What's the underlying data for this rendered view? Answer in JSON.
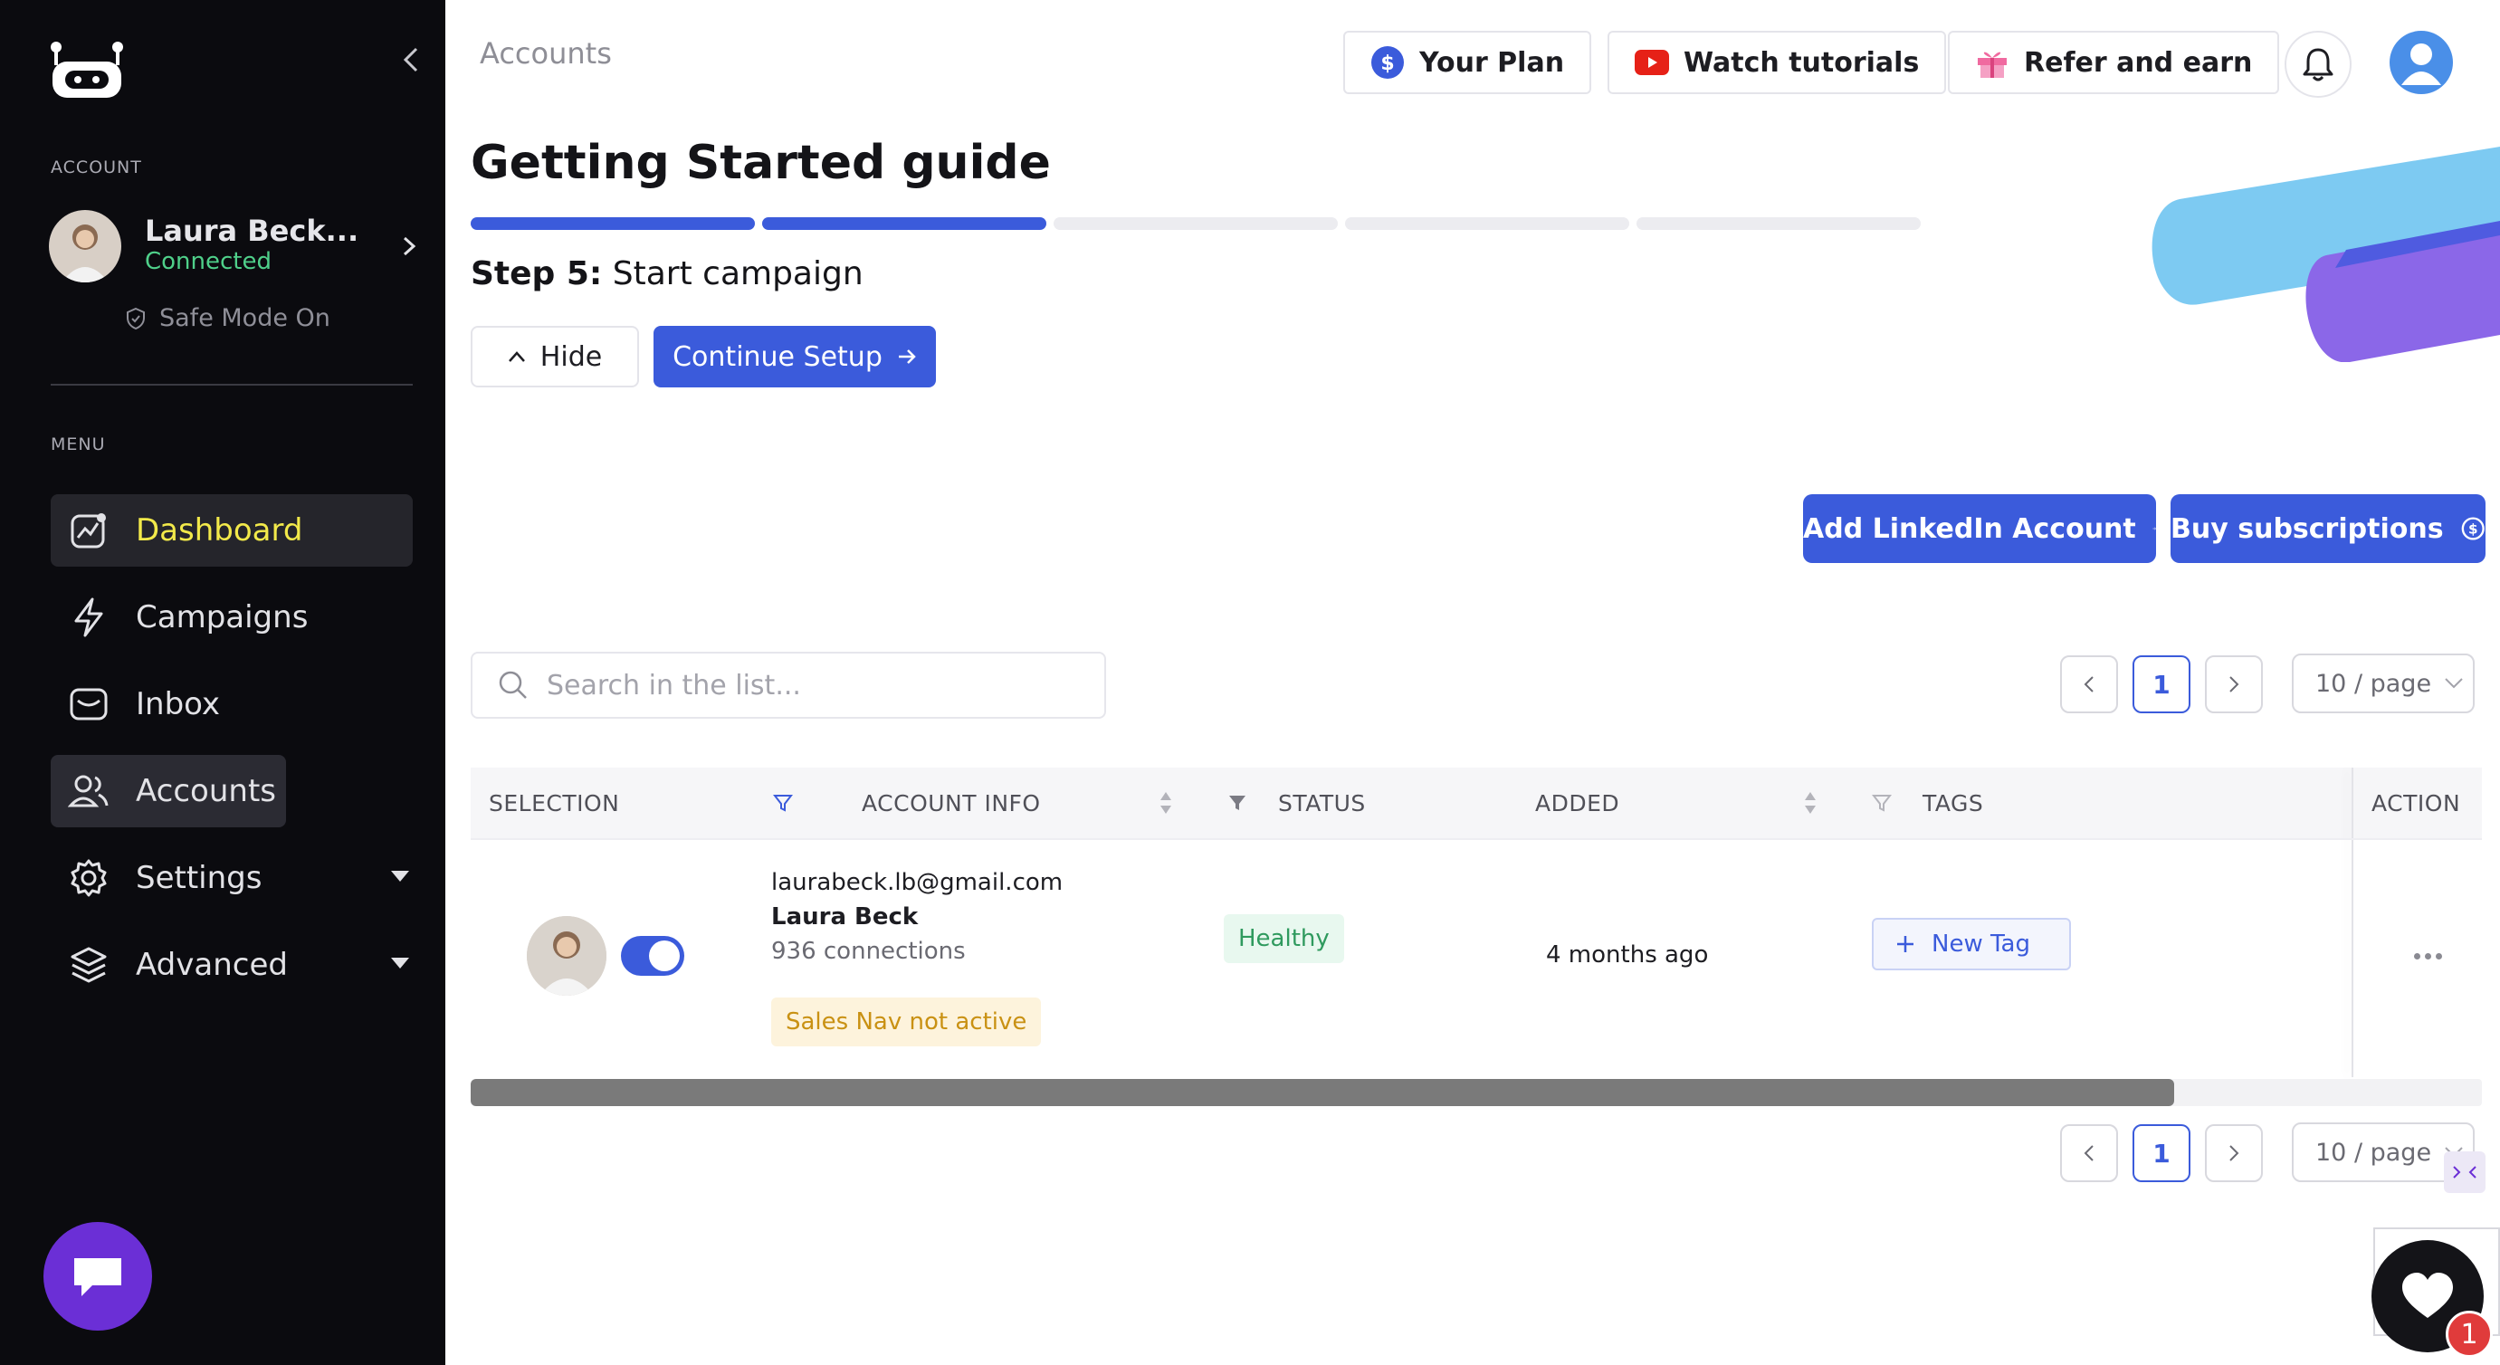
{
  "sidebar": {
    "account_section": "ACCOUNT",
    "account_name": "Laura Beck...",
    "account_status": "Connected",
    "safe_mode": "Safe Mode On",
    "menu_section": "MENU",
    "items": [
      {
        "label": "Dashboard",
        "icon": "dashboard-icon",
        "state": "active"
      },
      {
        "label": "Campaigns",
        "icon": "lightning-icon"
      },
      {
        "label": "Inbox",
        "icon": "inbox-icon"
      },
      {
        "label": "Accounts",
        "icon": "users-icon",
        "state": "selected"
      },
      {
        "label": "Settings",
        "icon": "gear-icon",
        "has_dropdown": true
      },
      {
        "label": "Advanced",
        "icon": "layers-icon",
        "has_dropdown": true
      }
    ]
  },
  "header": {
    "breadcrumb": "Accounts",
    "your_plan": "Your Plan",
    "watch_tutorials": "Watch tutorials",
    "refer_and_earn": "Refer and earn"
  },
  "guide": {
    "title": "Getting Started guide",
    "steps_total": 5,
    "steps_done": 2,
    "step_prefix": "Step 5:",
    "step_name": "Start campaign",
    "hide_label": "Hide",
    "continue_label": "Continue Setup"
  },
  "actions": {
    "add_linkedin": "Add LinkedIn Account",
    "buy_subscriptions": "Buy subscriptions"
  },
  "search": {
    "placeholder": "Search in the list..."
  },
  "pagination": {
    "current_page": "1",
    "page_size": "10 / page"
  },
  "table": {
    "headers": {
      "selection": "SELECTION",
      "account_info": "ACCOUNT INFO",
      "status": "STATUS",
      "added": "ADDED",
      "tags": "TAGS",
      "action": "ACTION"
    },
    "rows": [
      {
        "email": "laurabeck.lb@gmail.com",
        "name": "Laura Beck",
        "connections": "936 connections",
        "sales_nav": "Sales Nav not active",
        "status": "Healthy",
        "added": "4 months ago",
        "tag_button": "New Tag",
        "selected": true
      }
    ]
  },
  "support": {
    "badge_count": "1"
  },
  "colors": {
    "sidebar_bg": "#0b0b0f",
    "accent": "#3b5bdb",
    "active_nav_text": "#f2e94a",
    "connected": "#4fd08a",
    "healthy_text": "#2f9a5e",
    "salesnav_text": "#c99113",
    "chat_fab": "#6b2fd6"
  }
}
